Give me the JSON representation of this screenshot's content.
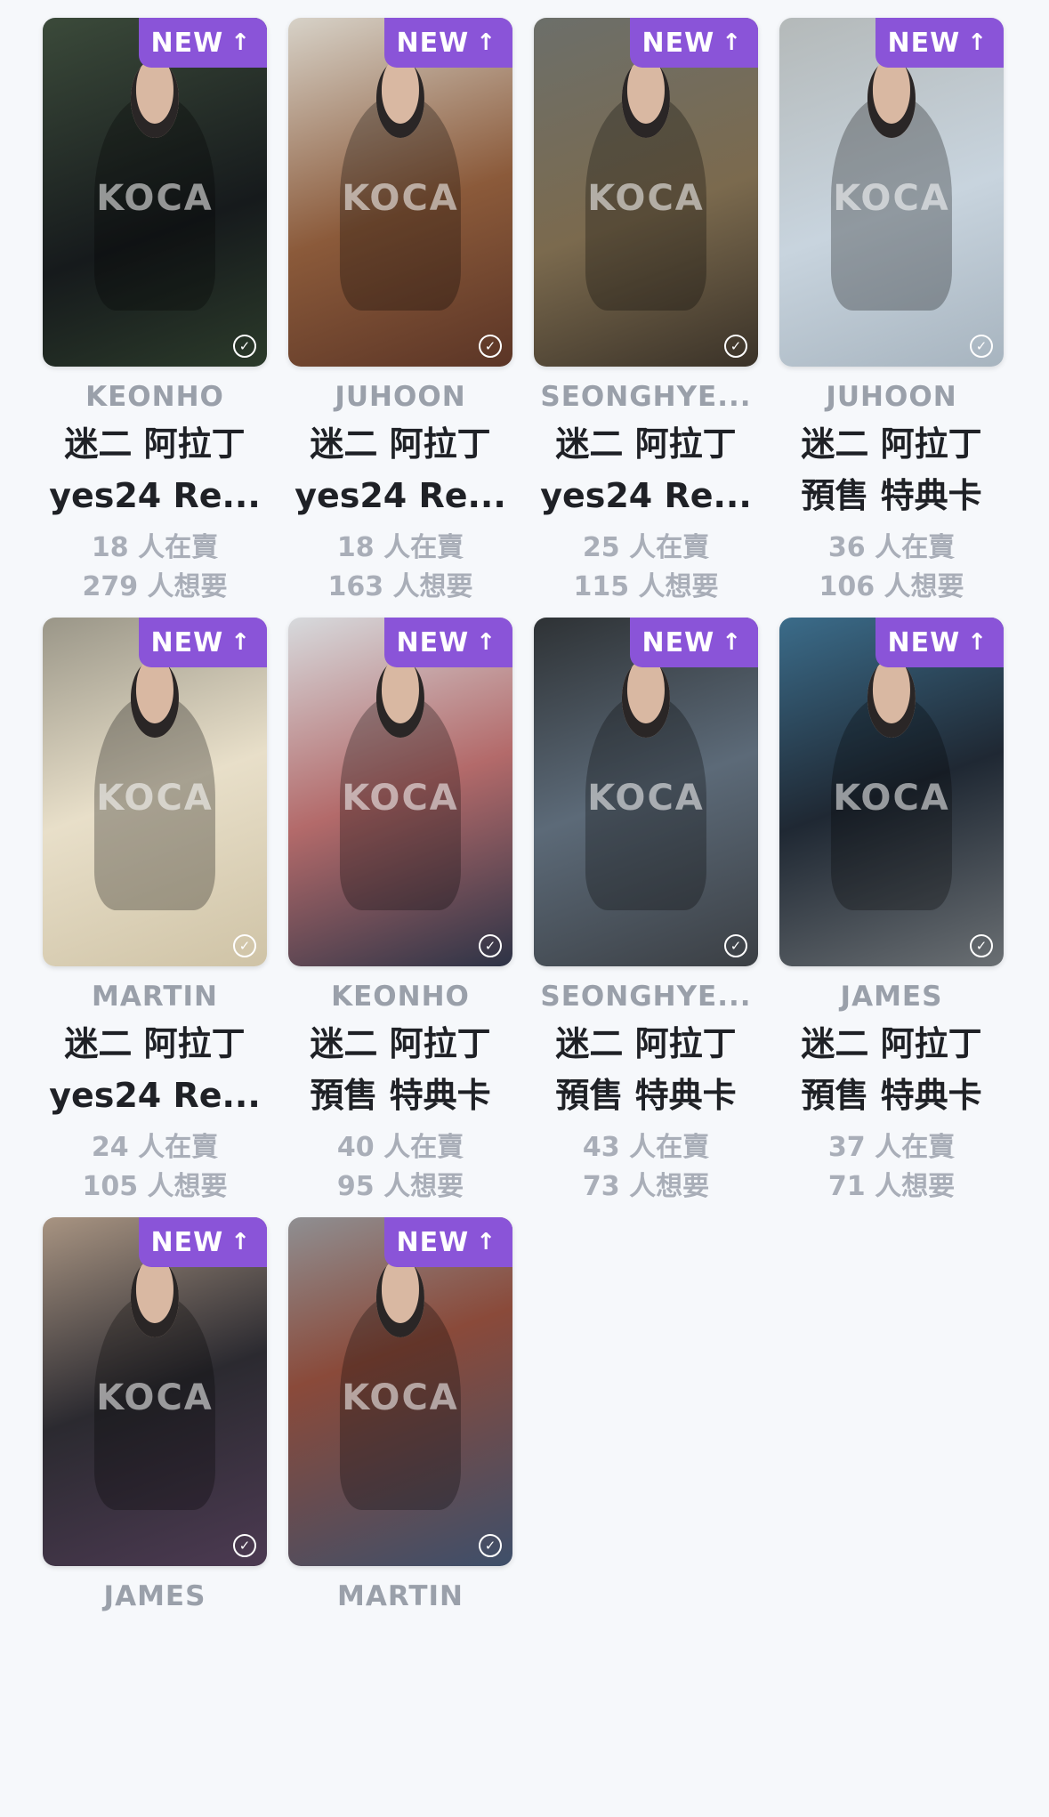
{
  "watermark": "KOCA",
  "badge": {
    "label": "NEW",
    "icon": "arrow-up-icon"
  },
  "check_icon": "check-circle-icon",
  "colors": {
    "badge_bg": "#8a54d8",
    "member_text": "#9aa0aa",
    "title_text": "#1f2126",
    "stats_text": "#a9aeb8",
    "page_bg": "#f6f8fb"
  },
  "cards": [
    {
      "member": "KEONHO",
      "title_line1": "迷二 阿拉丁",
      "title_line2": "yes24 Re...",
      "selling": "18 人在賣",
      "wanting": "279 人想要"
    },
    {
      "member": "JUHOON",
      "title_line1": "迷二 阿拉丁",
      "title_line2": "yes24 Re...",
      "selling": "18 人在賣",
      "wanting": "163 人想要"
    },
    {
      "member": "SEONGHYE...",
      "title_line1": "迷二 阿拉丁",
      "title_line2": "yes24 Re...",
      "selling": "25 人在賣",
      "wanting": "115 人想要"
    },
    {
      "member": "JUHOON",
      "title_line1": "迷二 阿拉丁",
      "title_line2": "預售 特典卡",
      "selling": "36 人在賣",
      "wanting": "106 人想要"
    },
    {
      "member": "MARTIN",
      "title_line1": "迷二 阿拉丁",
      "title_line2": "yes24 Re...",
      "selling": "24 人在賣",
      "wanting": "105 人想要"
    },
    {
      "member": "KEONHO",
      "title_line1": "迷二 阿拉丁",
      "title_line2": "預售 特典卡",
      "selling": "40 人在賣",
      "wanting": "95 人想要"
    },
    {
      "member": "SEONGHYE...",
      "title_line1": "迷二 阿拉丁",
      "title_line2": "預售 特典卡",
      "selling": "43 人在賣",
      "wanting": "73 人想要"
    },
    {
      "member": "JAMES",
      "title_line1": "迷二 阿拉丁",
      "title_line2": "預售 特典卡",
      "selling": "37 人在賣",
      "wanting": "71 人想要"
    },
    {
      "member": "JAMES"
    },
    {
      "member": "MARTIN"
    }
  ]
}
